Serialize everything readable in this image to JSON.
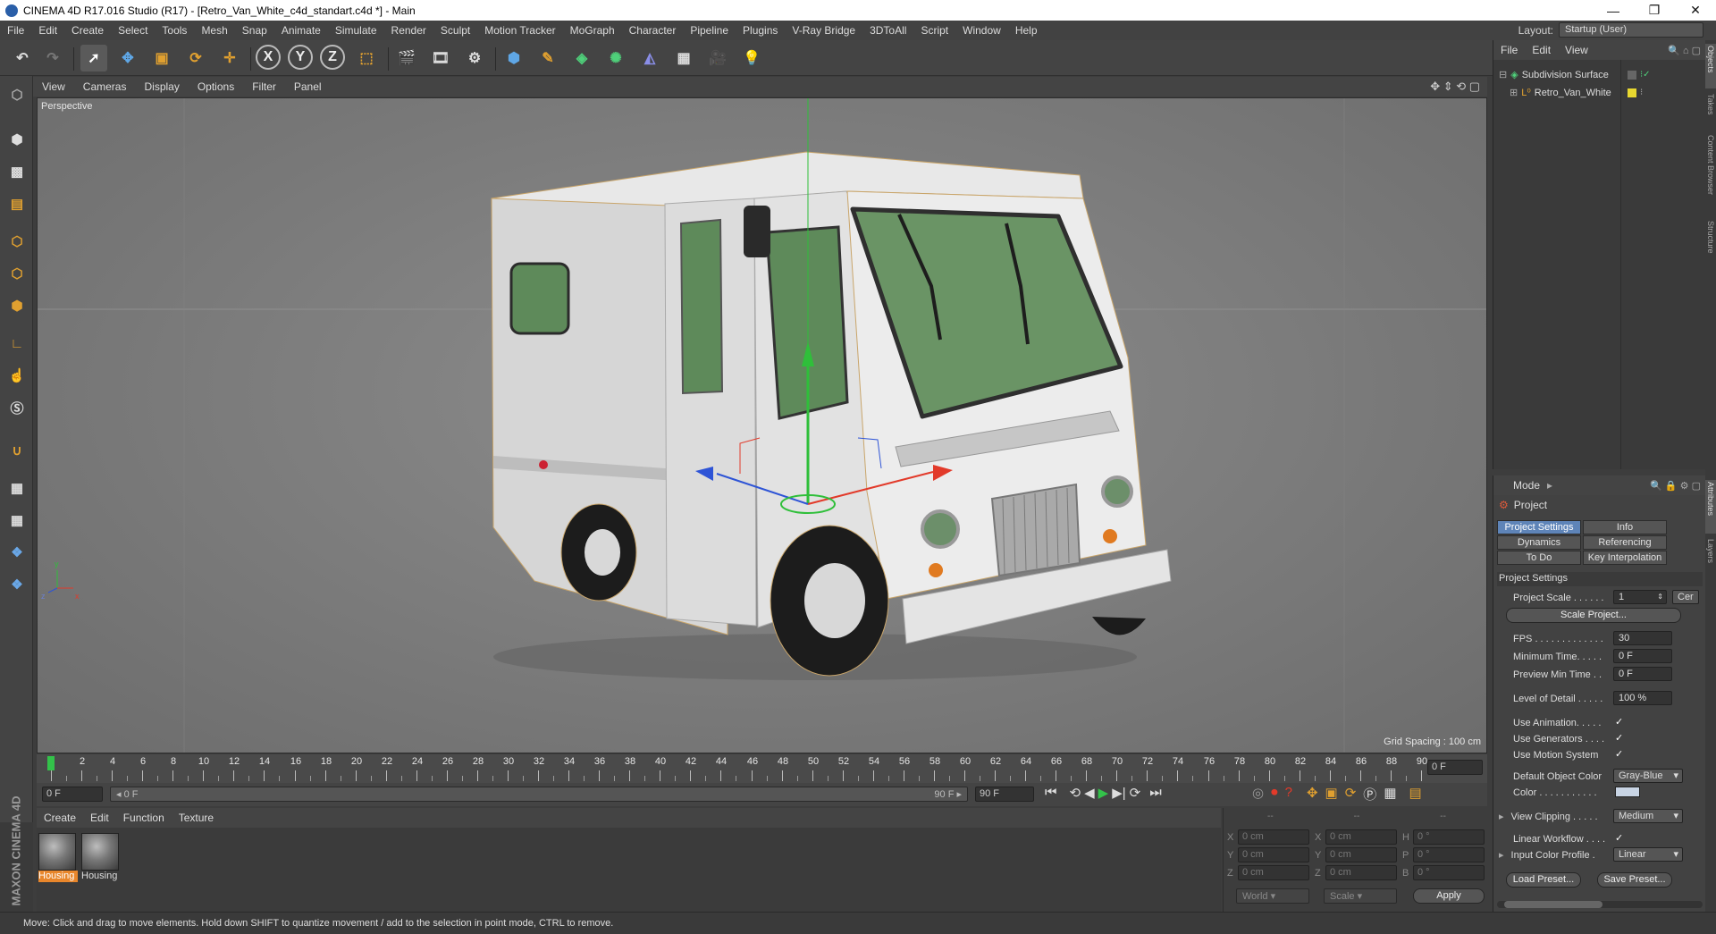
{
  "window": {
    "title": "CINEMA 4D R17.016 Studio (R17) - [Retro_Van_White_c4d_standart.c4d *] - Main",
    "controls": [
      "—",
      "❐",
      "✕"
    ]
  },
  "menubar": {
    "items": [
      "File",
      "Edit",
      "Create",
      "Select",
      "Tools",
      "Mesh",
      "Snap",
      "Animate",
      "Simulate",
      "Render",
      "Sculpt",
      "Motion Tracker",
      "MoGraph",
      "Character",
      "Pipeline",
      "Plugins",
      "V-Ray Bridge",
      "3DToAll",
      "Script",
      "Window",
      "Help"
    ],
    "layout_label": "Layout:",
    "layout_value": "Startup (User)"
  },
  "toolbar": {
    "axis_x": "X",
    "axis_y": "Y",
    "axis_z": "Z"
  },
  "viewport": {
    "menu": [
      "View",
      "Cameras",
      "Display",
      "Options",
      "Filter",
      "Panel"
    ],
    "label": "Perspective",
    "grid_spacing": "Grid Spacing : 100 cm",
    "axis_y": "y",
    "axis_z": "z",
    "axis_x": "x"
  },
  "timeline": {
    "ticks": [
      "0",
      "2",
      "4",
      "6",
      "8",
      "10",
      "12",
      "14",
      "16",
      "18",
      "20",
      "22",
      "24",
      "26",
      "28",
      "30",
      "32",
      "34",
      "36",
      "38",
      "40",
      "42",
      "44",
      "46",
      "48",
      "50",
      "52",
      "54",
      "56",
      "58",
      "60",
      "62",
      "64",
      "66",
      "68",
      "70",
      "72",
      "74",
      "76",
      "78",
      "80",
      "82",
      "84",
      "86",
      "88",
      "90"
    ],
    "current_frame": "0 F",
    "start": "0 F",
    "range_start": "◂ 0 F",
    "range_end": "90 F ▸",
    "end": "90 F",
    "playhead_fraction": 0.0
  },
  "materials": {
    "menu": [
      "Create",
      "Edit",
      "Function",
      "Texture"
    ],
    "items": [
      {
        "label": "Housing",
        "selected": true
      },
      {
        "label": "Housing",
        "selected": false
      }
    ]
  },
  "coordinates": {
    "header": [
      "--",
      "--",
      "--"
    ],
    "rows": [
      {
        "a": "X",
        "av": "0 cm",
        "b": "X",
        "bv": "0 cm",
        "c": "H",
        "cv": "0 °"
      },
      {
        "a": "Y",
        "av": "0 cm",
        "b": "Y",
        "bv": "0 cm",
        "c": "P",
        "cv": "0 °"
      },
      {
        "a": "Z",
        "av": "0 cm",
        "b": "Z",
        "bv": "0 cm",
        "c": "B",
        "cv": "0 °"
      }
    ],
    "space": "World",
    "mode": "Scale",
    "apply": "Apply"
  },
  "object_manager": {
    "menu": [
      "File",
      "Edit",
      "View"
    ],
    "objects": [
      {
        "name": "Subdivision Surface",
        "indent": 0
      },
      {
        "name": "Retro_Van_White",
        "indent": 1
      }
    ]
  },
  "right_tabs": [
    "Objects",
    "Takes",
    "Content Browser",
    "Structure",
    "Attributes",
    "Layers"
  ],
  "attributes": {
    "mode": "Mode",
    "title": "Project",
    "tabs": [
      {
        "label": "Project Settings",
        "active": true
      },
      {
        "label": "Info",
        "active": false
      },
      {
        "label": "Dynamics",
        "active": false
      },
      {
        "label": "Referencing",
        "active": false
      },
      {
        "label": "To Do",
        "active": false
      },
      {
        "label": "Key Interpolation",
        "active": false
      }
    ],
    "section": "Project Settings",
    "project_scale_label": "Project Scale . . . . . .",
    "project_scale_value": "1",
    "project_scale_unit": "Cer",
    "scale_project_button": "Scale Project...",
    "fps_label": "FPS . . . . . . . . . . . . .",
    "fps_value": "30",
    "min_time_label": "Minimum Time. . . . .",
    "min_time_value": "0 F",
    "preview_min_label": "Preview Min Time . .",
    "preview_min_value": "0 F",
    "lod_label": "Level of Detail . . . . .",
    "lod_value": "100 %",
    "use_anim_label": "Use Animation. . . . .",
    "use_gen_label": "Use Generators . . . .",
    "use_motion_label": "Use Motion System",
    "check": "✓",
    "default_color_label": "Default Object Color",
    "default_color_value": "Gray-Blue",
    "color_label": "Color . . . . . . . . . . .",
    "color_swatch": "#c8d4e4",
    "view_clipping_label": "View Clipping . . . . .",
    "view_clipping_value": "Medium",
    "linear_wf_label": "Linear Workflow . . . .",
    "input_profile_label": "Input Color Profile .",
    "input_profile_value": "Linear",
    "load_preset": "Load Preset...",
    "save_preset": "Save Preset..."
  },
  "status": {
    "text": "Move: Click and drag to move elements. Hold down SHIFT to quantize movement / add to the selection in point mode, CTRL to remove."
  },
  "maxon_logo": "MAXON CINEMA 4D",
  "colors": {
    "accent_blue": "#5e84b8",
    "selected_orange": "#e8862b",
    "axis_green": "#2fbf3a",
    "axis_red": "#e23a2a",
    "axis_blue": "#2e54d6"
  }
}
